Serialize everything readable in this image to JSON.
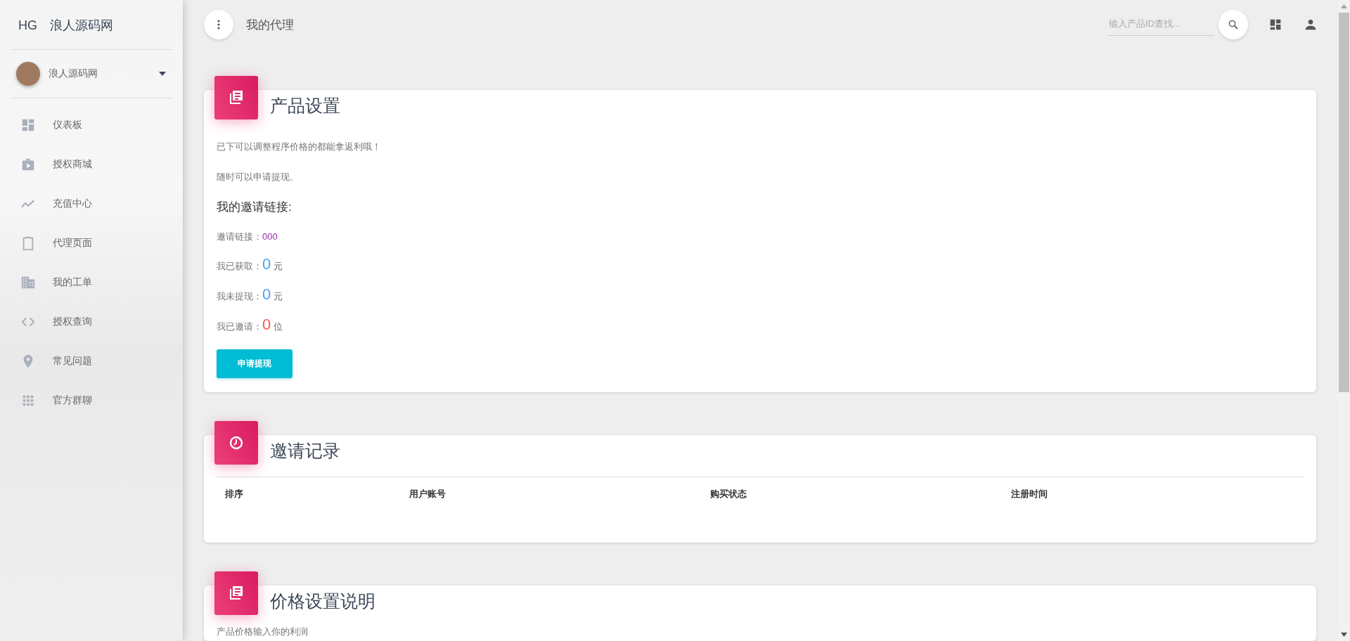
{
  "sidebar": {
    "logo": "HG",
    "brand": "浪人源码网",
    "user": {
      "name": "浪人源码网",
      "expanded": false
    },
    "items": [
      {
        "label": "仪表板",
        "selected": false
      },
      {
        "label": "授权商城",
        "selected": false
      },
      {
        "label": "充值中心",
        "selected": false
      },
      {
        "label": "代理页面",
        "selected": false
      },
      {
        "label": "我的工单",
        "selected": false
      },
      {
        "label": "授权查询",
        "selected": false
      },
      {
        "label": "常见问题",
        "selected": false
      },
      {
        "label": "官方群聊",
        "selected": false
      }
    ]
  },
  "topbar": {
    "title": "我的代理",
    "search": {
      "placeholder": "输入产品ID查找..."
    }
  },
  "product_card": {
    "title": "产品设置",
    "paragraphs": [
      "已下可以调整程序价格的都能拿返利哦！",
      "随时可以申请提现。"
    ],
    "subheading": "我的邀请链接:",
    "invite": {
      "label": "邀请链接：",
      "value": "000"
    },
    "stats": [
      {
        "label": "我已获取：",
        "value": "0",
        "unit": "元",
        "color": "#4c9df8"
      },
      {
        "label": "我未提现：",
        "value": "0",
        "unit": "元",
        "color": "#4c9df8"
      },
      {
        "label": "我已邀请：",
        "value": "0",
        "unit": "位",
        "color": "#f55a4e"
      }
    ],
    "button": "申请提现"
  },
  "records_card": {
    "title": "邀请记录",
    "columns": [
      "排序",
      "用户账号",
      "购买状态",
      "注册时间"
    ]
  },
  "pricing_card": {
    "title": "价格设置说明",
    "text": "产品价格输入你的利润"
  }
}
